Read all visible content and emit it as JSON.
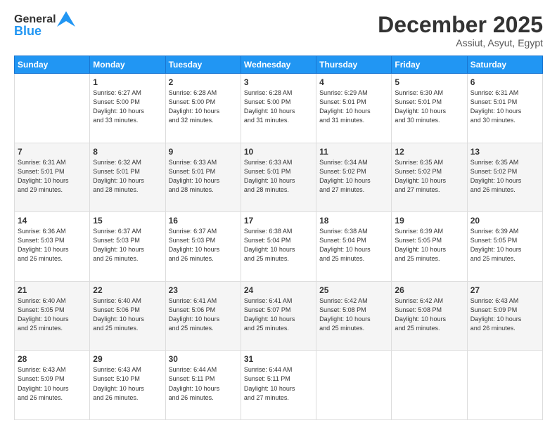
{
  "header": {
    "logo_line1": "General",
    "logo_line2": "Blue",
    "month_title": "December 2025",
    "subtitle": "Assiut, Asyut, Egypt"
  },
  "weekdays": [
    "Sunday",
    "Monday",
    "Tuesday",
    "Wednesday",
    "Thursday",
    "Friday",
    "Saturday"
  ],
  "weeks": [
    [
      {
        "day": "",
        "text": ""
      },
      {
        "day": "1",
        "text": "Sunrise: 6:27 AM\nSunset: 5:00 PM\nDaylight: 10 hours\nand 33 minutes."
      },
      {
        "day": "2",
        "text": "Sunrise: 6:28 AM\nSunset: 5:00 PM\nDaylight: 10 hours\nand 32 minutes."
      },
      {
        "day": "3",
        "text": "Sunrise: 6:28 AM\nSunset: 5:00 PM\nDaylight: 10 hours\nand 31 minutes."
      },
      {
        "day": "4",
        "text": "Sunrise: 6:29 AM\nSunset: 5:01 PM\nDaylight: 10 hours\nand 31 minutes."
      },
      {
        "day": "5",
        "text": "Sunrise: 6:30 AM\nSunset: 5:01 PM\nDaylight: 10 hours\nand 30 minutes."
      },
      {
        "day": "6",
        "text": "Sunrise: 6:31 AM\nSunset: 5:01 PM\nDaylight: 10 hours\nand 30 minutes."
      }
    ],
    [
      {
        "day": "7",
        "text": "Sunrise: 6:31 AM\nSunset: 5:01 PM\nDaylight: 10 hours\nand 29 minutes."
      },
      {
        "day": "8",
        "text": "Sunrise: 6:32 AM\nSunset: 5:01 PM\nDaylight: 10 hours\nand 28 minutes."
      },
      {
        "day": "9",
        "text": "Sunrise: 6:33 AM\nSunset: 5:01 PM\nDaylight: 10 hours\nand 28 minutes."
      },
      {
        "day": "10",
        "text": "Sunrise: 6:33 AM\nSunset: 5:01 PM\nDaylight: 10 hours\nand 28 minutes."
      },
      {
        "day": "11",
        "text": "Sunrise: 6:34 AM\nSunset: 5:02 PM\nDaylight: 10 hours\nand 27 minutes."
      },
      {
        "day": "12",
        "text": "Sunrise: 6:35 AM\nSunset: 5:02 PM\nDaylight: 10 hours\nand 27 minutes."
      },
      {
        "day": "13",
        "text": "Sunrise: 6:35 AM\nSunset: 5:02 PM\nDaylight: 10 hours\nand 26 minutes."
      }
    ],
    [
      {
        "day": "14",
        "text": "Sunrise: 6:36 AM\nSunset: 5:03 PM\nDaylight: 10 hours\nand 26 minutes."
      },
      {
        "day": "15",
        "text": "Sunrise: 6:37 AM\nSunset: 5:03 PM\nDaylight: 10 hours\nand 26 minutes."
      },
      {
        "day": "16",
        "text": "Sunrise: 6:37 AM\nSunset: 5:03 PM\nDaylight: 10 hours\nand 26 minutes."
      },
      {
        "day": "17",
        "text": "Sunrise: 6:38 AM\nSunset: 5:04 PM\nDaylight: 10 hours\nand 25 minutes."
      },
      {
        "day": "18",
        "text": "Sunrise: 6:38 AM\nSunset: 5:04 PM\nDaylight: 10 hours\nand 25 minutes."
      },
      {
        "day": "19",
        "text": "Sunrise: 6:39 AM\nSunset: 5:05 PM\nDaylight: 10 hours\nand 25 minutes."
      },
      {
        "day": "20",
        "text": "Sunrise: 6:39 AM\nSunset: 5:05 PM\nDaylight: 10 hours\nand 25 minutes."
      }
    ],
    [
      {
        "day": "21",
        "text": "Sunrise: 6:40 AM\nSunset: 5:05 PM\nDaylight: 10 hours\nand 25 minutes."
      },
      {
        "day": "22",
        "text": "Sunrise: 6:40 AM\nSunset: 5:06 PM\nDaylight: 10 hours\nand 25 minutes."
      },
      {
        "day": "23",
        "text": "Sunrise: 6:41 AM\nSunset: 5:06 PM\nDaylight: 10 hours\nand 25 minutes."
      },
      {
        "day": "24",
        "text": "Sunrise: 6:41 AM\nSunset: 5:07 PM\nDaylight: 10 hours\nand 25 minutes."
      },
      {
        "day": "25",
        "text": "Sunrise: 6:42 AM\nSunset: 5:08 PM\nDaylight: 10 hours\nand 25 minutes."
      },
      {
        "day": "26",
        "text": "Sunrise: 6:42 AM\nSunset: 5:08 PM\nDaylight: 10 hours\nand 25 minutes."
      },
      {
        "day": "27",
        "text": "Sunrise: 6:43 AM\nSunset: 5:09 PM\nDaylight: 10 hours\nand 26 minutes."
      }
    ],
    [
      {
        "day": "28",
        "text": "Sunrise: 6:43 AM\nSunset: 5:09 PM\nDaylight: 10 hours\nand 26 minutes."
      },
      {
        "day": "29",
        "text": "Sunrise: 6:43 AM\nSunset: 5:10 PM\nDaylight: 10 hours\nand 26 minutes."
      },
      {
        "day": "30",
        "text": "Sunrise: 6:44 AM\nSunset: 5:11 PM\nDaylight: 10 hours\nand 26 minutes."
      },
      {
        "day": "31",
        "text": "Sunrise: 6:44 AM\nSunset: 5:11 PM\nDaylight: 10 hours\nand 27 minutes."
      },
      {
        "day": "",
        "text": ""
      },
      {
        "day": "",
        "text": ""
      },
      {
        "day": "",
        "text": ""
      }
    ]
  ]
}
